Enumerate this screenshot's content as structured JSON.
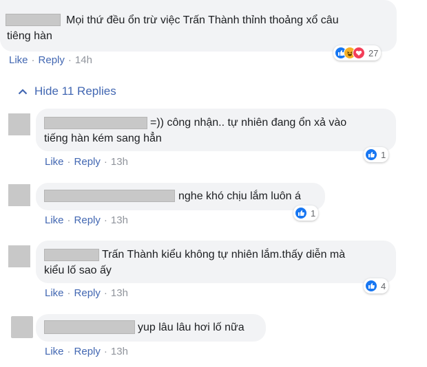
{
  "main_comment": {
    "text_line1": "Mọi thứ đều ổn trừ việc Trấn Thành thỉnh thoảng xổ câu",
    "text_line2": "tiêng hàn",
    "like": "Like",
    "reply": "Reply",
    "time": "14h",
    "reaction_count": "27"
  },
  "toggle": {
    "label": "Hide 11 Replies"
  },
  "replies": [
    {
      "text_line1": "=)) công nhận.. tự nhiên đang ổn xả vào",
      "text_line2": "tiếng hàn kém sang hẳn",
      "like": "Like",
      "reply": "Reply",
      "time": "13h",
      "reaction_count": "1"
    },
    {
      "text_line1": "nghe khó chịu lắm luôn á",
      "like": "Like",
      "reply": "Reply",
      "time": "13h",
      "reaction_count": "1"
    },
    {
      "text_line1": "Trấn Thành kiểu không tự nhiên lắm.thấy diễn mà",
      "text_line2": "kiểu lố sao ấy",
      "like": "Like",
      "reply": "Reply",
      "time": "13h",
      "reaction_count": "4"
    },
    {
      "text_line1": "yup lâu lâu hơi lố nữa",
      "like": "Like",
      "reply": "Reply",
      "time": "13h"
    }
  ],
  "colors": {
    "link": "#4267b2",
    "bubble": "#f2f3f5",
    "like_blue": "#1877f2",
    "haha": "#f7b125",
    "love": "#f33e58"
  }
}
